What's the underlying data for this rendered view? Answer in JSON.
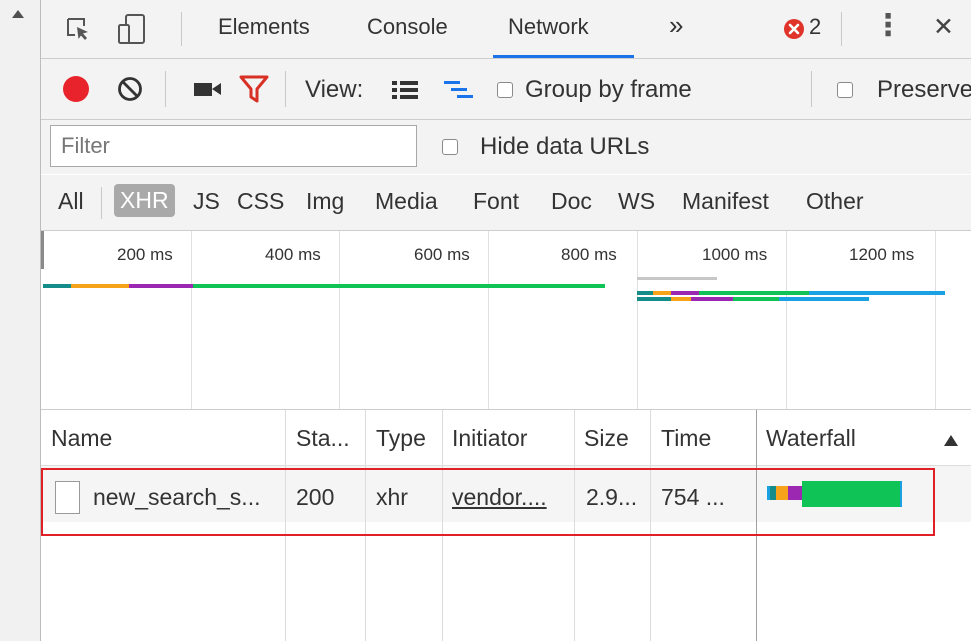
{
  "tabs": {
    "elements": "Elements",
    "console": "Console",
    "network": "Network",
    "more": "»",
    "error_count": "2",
    "menu": "⋮",
    "close": "✕"
  },
  "toolbar": {
    "view_label": "View:",
    "group_by_frame": "Group by frame",
    "preserve_log": "Preserve"
  },
  "filter": {
    "placeholder": "Filter",
    "hide_data_urls": "Hide data URLs"
  },
  "type_filters": [
    "All",
    "XHR",
    "JS",
    "CSS",
    "Img",
    "Media",
    "Font",
    "Doc",
    "WS",
    "Manifest",
    "Other"
  ],
  "overview": {
    "ticks": [
      "200 ms",
      "400 ms",
      "600 ms",
      "800 ms",
      "1000 ms",
      "1200 ms"
    ]
  },
  "table": {
    "columns": [
      "Name",
      "Sta...",
      "Type",
      "Initiator",
      "Size",
      "Time",
      "Waterfall"
    ],
    "rows": [
      {
        "name": "new_search_s...",
        "status": "200",
        "type": "xhr",
        "initiator": "vendor....",
        "size": "2.9...",
        "time": "754 ..."
      }
    ]
  },
  "colors": {
    "record": "#e8232b",
    "filter_active": "#d93025",
    "highlight": "#e01f26",
    "waterfall_green": "#0fc357",
    "waterfall_orange": "#f7a21b",
    "waterfall_purple": "#9c27b0",
    "waterfall_blue": "#1ba1e2"
  }
}
